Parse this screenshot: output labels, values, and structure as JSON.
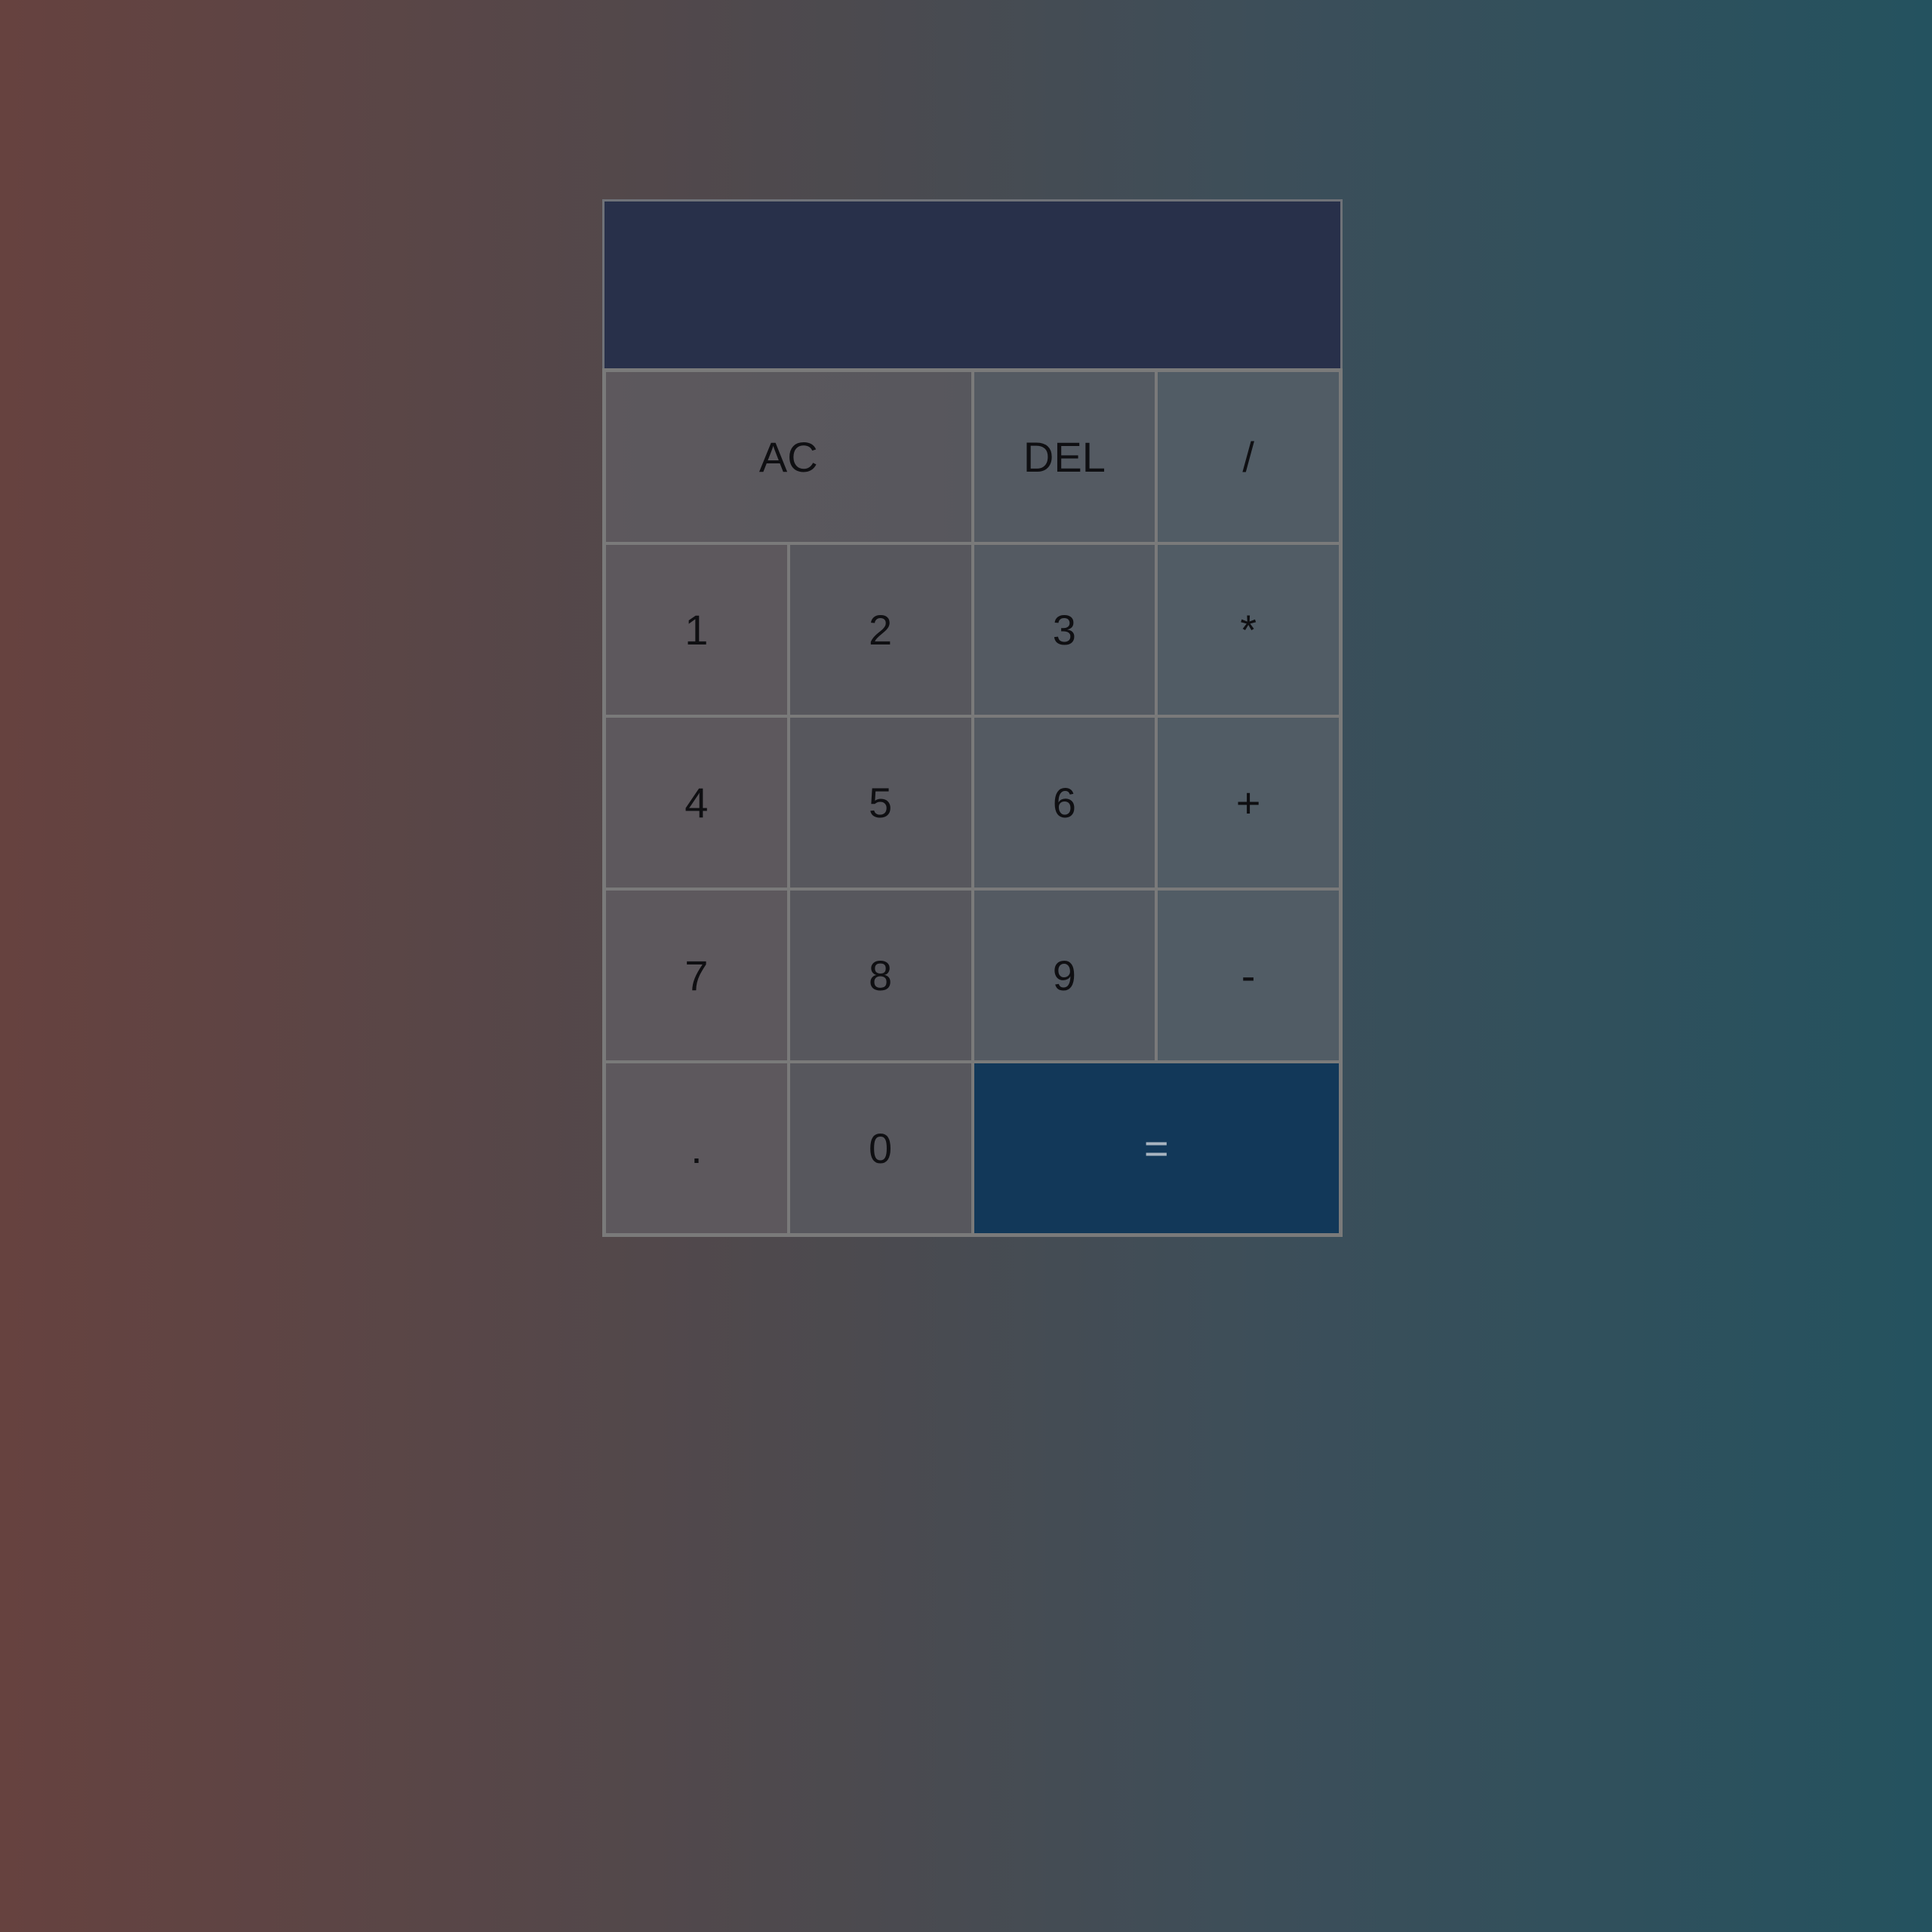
{
  "display": {
    "previous_operand": "",
    "current_operand": ""
  },
  "keys": {
    "all_clear": "AC",
    "delete": "DEL",
    "divide": "/",
    "one": "1",
    "two": "2",
    "three": "3",
    "multiply": "*",
    "four": "4",
    "five": "5",
    "six": "6",
    "add": "+",
    "seven": "7",
    "eight": "8",
    "nine": "9",
    "subtract": "-",
    "decimal": ".",
    "zero": "0",
    "equals": "="
  },
  "colors": {
    "display_background": "#28304a",
    "equals_background": "#123859",
    "key_border": "#7a7a7a"
  }
}
